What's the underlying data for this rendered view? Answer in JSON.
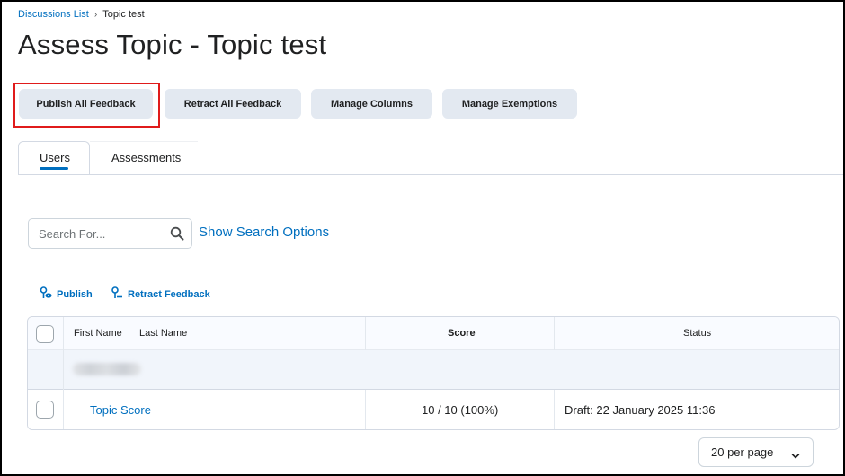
{
  "breadcrumb": {
    "parent": "Discussions List",
    "separator": "›",
    "current": "Topic test"
  },
  "page": {
    "title": "Assess Topic - Topic test"
  },
  "toolbar": {
    "publish_all": "Publish All Feedback",
    "retract_all": "Retract All Feedback",
    "manage_columns": "Manage Columns",
    "manage_exemptions": "Manage Exemptions"
  },
  "tabs": [
    {
      "label": "Users",
      "active": true
    },
    {
      "label": "Assessments",
      "active": false
    }
  ],
  "search": {
    "placeholder": "Search For...",
    "value": "",
    "show_options": "Show Search Options"
  },
  "actions": {
    "publish": "Publish",
    "retract": "Retract Feedback"
  },
  "table": {
    "headers": {
      "first_name": "First Name",
      "last_name": "Last Name",
      "score": "Score",
      "status": "Status"
    },
    "rows": [
      {
        "name": "Topic Score",
        "score": "10 / 10 (100%)",
        "status": "Draft: 22 January 2025 11:36"
      }
    ]
  },
  "pagination": {
    "per_page": "20 per page"
  },
  "colors": {
    "link": "#006fbf",
    "button_bg": "#e3e9f1",
    "highlight": "#e01b1b"
  },
  "icons": [
    "search-icon",
    "publish-icon",
    "retract-feedback-icon",
    "chevron-down-icon"
  ]
}
